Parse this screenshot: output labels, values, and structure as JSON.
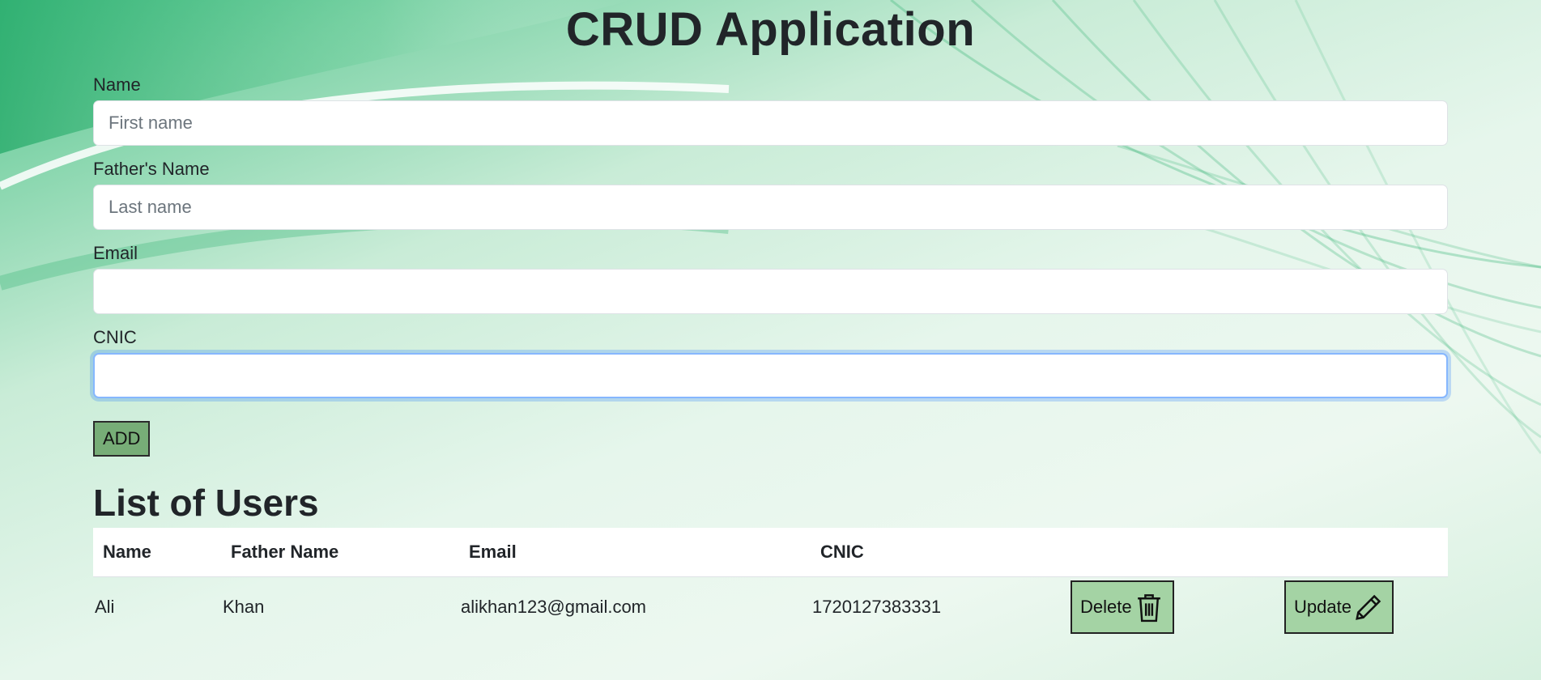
{
  "app": {
    "title": "CRUD Application"
  },
  "form": {
    "name": {
      "label": "Name",
      "placeholder": "First name",
      "value": ""
    },
    "father": {
      "label": "Father's Name",
      "placeholder": "Last name",
      "value": ""
    },
    "email": {
      "label": "Email",
      "placeholder": "",
      "value": ""
    },
    "cnic": {
      "label": "CNIC",
      "placeholder": "",
      "value": ""
    },
    "add_label": "ADD"
  },
  "list": {
    "title": "List of Users",
    "columns": [
      "Name",
      "Father Name",
      "Email",
      "CNIC"
    ],
    "rows": [
      {
        "name": "Ali",
        "father": "Khan",
        "email": "alikhan123@gmail.com",
        "cnic": "1720127383331"
      }
    ],
    "delete_label": "Delete",
    "update_label": "Update",
    "delete_icon": "trash-icon",
    "update_icon": "pencil-icon"
  },
  "colors": {
    "accent_green": "#3fbf84",
    "add_button": "#77ad77",
    "action_button": "#a4d3a4",
    "focus_ring": "#86b7fe"
  }
}
